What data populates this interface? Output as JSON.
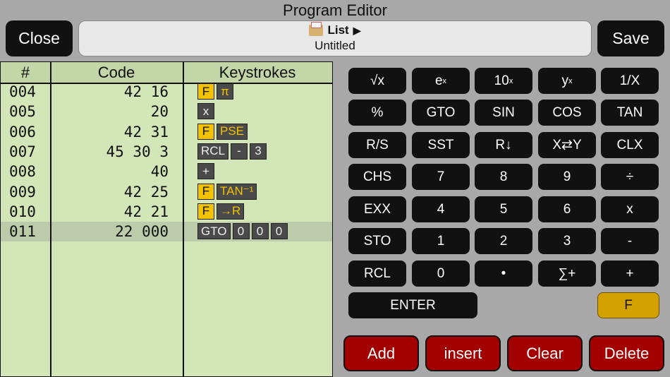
{
  "title": "Program Editor",
  "header": {
    "close_label": "Close",
    "save_label": "Save",
    "program_type": "List",
    "program_name": "Untitled"
  },
  "listing": {
    "columns": [
      "#",
      "Code",
      "Keystrokes"
    ],
    "rows": [
      {
        "num": "004",
        "code": "42 16",
        "keys": [
          "F",
          "π"
        ],
        "selected": false
      },
      {
        "num": "005",
        "code": "20",
        "keys": [
          "x"
        ],
        "selected": false
      },
      {
        "num": "006",
        "code": "42 31",
        "keys": [
          "F",
          "PSE"
        ],
        "selected": false
      },
      {
        "num": "007",
        "code": "45 30 3",
        "keys": [
          "RCL",
          "-",
          "3"
        ],
        "selected": false
      },
      {
        "num": "008",
        "code": "40",
        "keys": [
          "+"
        ],
        "selected": false
      },
      {
        "num": "009",
        "code": "42 25",
        "keys": [
          "F",
          "TAN⁻¹"
        ],
        "selected": false
      },
      {
        "num": "010",
        "code": "42 21",
        "keys": [
          "F",
          "→R"
        ],
        "selected": false
      },
      {
        "num": "011",
        "code": "22 000",
        "keys": [
          "GTO",
          "0",
          "0",
          "0"
        ],
        "selected": true
      }
    ]
  },
  "keypad": {
    "rows": [
      [
        "√x",
        "eˣ",
        "10ˣ",
        "yˣ",
        "1/X"
      ],
      [
        "%",
        "GTO",
        "SIN",
        "COS",
        "TAN"
      ],
      [
        "R/S",
        "SST",
        "R↓",
        "X⇄Y",
        "CLX"
      ],
      [
        "CHS",
        "7",
        "8",
        "9",
        "÷"
      ],
      [
        "EXX",
        "4",
        "5",
        "6",
        "x"
      ],
      [
        "STO",
        "1",
        "2",
        "3",
        "-"
      ],
      [
        "RCL",
        "0",
        "•",
        "∑+",
        "+"
      ]
    ],
    "enter_label": "ENTER",
    "f_label": "F"
  },
  "actions": [
    "Add",
    "insert",
    "Clear",
    "Delete"
  ],
  "colors": {
    "f_key": "#d4a200",
    "action": "#a30000",
    "listing_bg": "#d3e6b8"
  }
}
